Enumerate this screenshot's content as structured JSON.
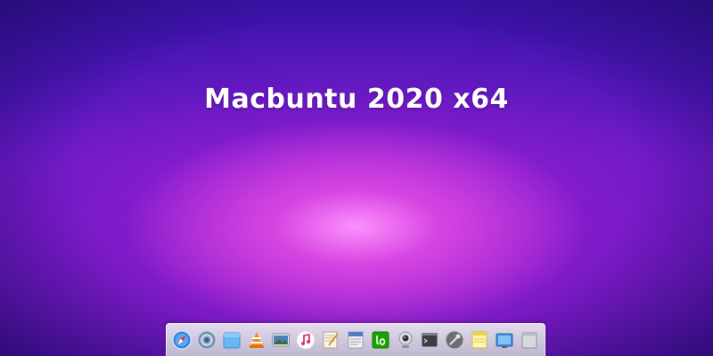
{
  "desktop": {
    "title": "Macbuntu 2020 x64"
  },
  "dock": {
    "items": [
      {
        "icon": "safari-icon"
      },
      {
        "icon": "launchpad-icon"
      },
      {
        "icon": "finder-folder-icon"
      },
      {
        "icon": "vlc-icon"
      },
      {
        "icon": "photos-icon"
      },
      {
        "icon": "music-icon"
      },
      {
        "icon": "text-editor-icon"
      },
      {
        "icon": "file-roller-icon"
      },
      {
        "icon": "libreoffice-icon"
      },
      {
        "icon": "webcam-icon"
      },
      {
        "icon": "terminal-icon"
      },
      {
        "icon": "system-settings-icon"
      },
      {
        "icon": "notes-icon"
      },
      {
        "icon": "screenshot-icon"
      },
      {
        "icon": "trash-icon"
      }
    ]
  },
  "colors": {
    "wallpaper_top": "#3a12a8",
    "wallpaper_glow": "#e050e0",
    "title_text": "#ffffff"
  }
}
